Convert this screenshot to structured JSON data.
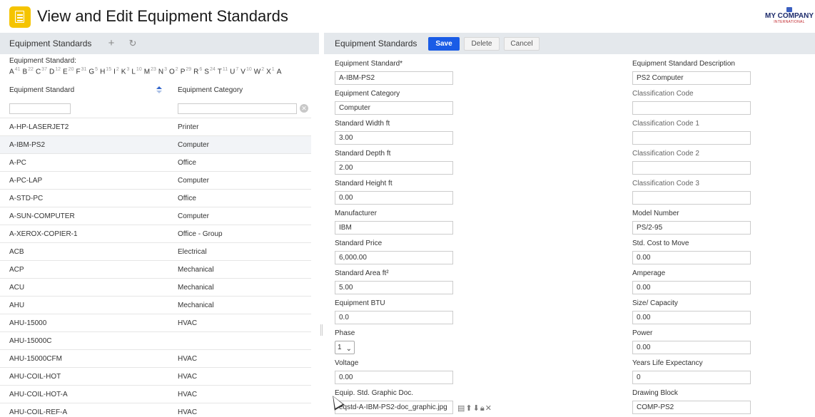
{
  "app": {
    "title": "View and Edit Equipment Standards",
    "logo_name": "MY COMPANY",
    "logo_sub": "INTERNATIONAL",
    "accent_color": "#f5c400",
    "primary_button_color": "#1a5ce6"
  },
  "list_panel": {
    "title": "Equipment Standards",
    "add_icon": "plus-icon",
    "refresh_icon": "refresh-icon",
    "index_label": "Equipment Standard:",
    "alphabet": [
      {
        "letter": "A",
        "count": "41"
      },
      {
        "letter": "B",
        "count": "22"
      },
      {
        "letter": "C",
        "count": "37"
      },
      {
        "letter": "D",
        "count": "12"
      },
      {
        "letter": "E",
        "count": "20"
      },
      {
        "letter": "F",
        "count": "31"
      },
      {
        "letter": "G",
        "count": "5"
      },
      {
        "letter": "H",
        "count": "15"
      },
      {
        "letter": "I",
        "count": "2"
      },
      {
        "letter": "K",
        "count": "3"
      },
      {
        "letter": "L",
        "count": "10"
      },
      {
        "letter": "M",
        "count": "23"
      },
      {
        "letter": "N",
        "count": "3"
      },
      {
        "letter": "O",
        "count": "2"
      },
      {
        "letter": "P",
        "count": "29"
      },
      {
        "letter": "R",
        "count": "6"
      },
      {
        "letter": "S",
        "count": "24"
      },
      {
        "letter": "T",
        "count": "11"
      },
      {
        "letter": "U",
        "count": "7"
      },
      {
        "letter": "V",
        "count": "10"
      },
      {
        "letter": "W",
        "count": "2"
      },
      {
        "letter": "X",
        "count": "1"
      },
      {
        "letter": "A",
        "count": ""
      }
    ],
    "columns": [
      "Equipment Standard",
      "Equipment Category"
    ],
    "filter_standard": "",
    "filter_category": "",
    "rows": [
      [
        "A-HP-LASERJET2",
        "Printer"
      ],
      [
        "A-IBM-PS2",
        "Computer"
      ],
      [
        "A-PC",
        "Office"
      ],
      [
        "A-PC-LAP",
        "Computer"
      ],
      [
        "A-STD-PC",
        "Office"
      ],
      [
        "A-SUN-COMPUTER",
        "Computer"
      ],
      [
        "A-XEROX-COPIER-1",
        "Office - Group"
      ],
      [
        "ACB",
        "Electrical"
      ],
      [
        "ACP",
        "Mechanical"
      ],
      [
        "ACU",
        "Mechanical"
      ],
      [
        "AHU",
        "Mechanical"
      ],
      [
        "AHU-15000",
        "HVAC"
      ],
      [
        "AHU-15000C",
        ""
      ],
      [
        "AHU-15000CFM",
        "HVAC"
      ],
      [
        "AHU-COIL-HOT",
        "HVAC"
      ],
      [
        "AHU-COIL-HOT-A",
        "HVAC"
      ],
      [
        "AHU-COIL-REF-A",
        "HVAC"
      ]
    ],
    "selected_row": 1
  },
  "form_panel": {
    "title": "Equipment Standards",
    "save_label": "Save",
    "delete_label": "Delete",
    "cancel_label": "Cancel",
    "left_fields": [
      {
        "label": "Equipment Standard*",
        "value": "A-IBM-PS2"
      },
      {
        "label": "Equipment Category",
        "value": "Computer"
      },
      {
        "label": "Standard Width ft",
        "value": "3.00"
      },
      {
        "label": "Standard Depth ft",
        "value": "2.00"
      },
      {
        "label": "Standard Height ft",
        "value": "0.00"
      },
      {
        "label": "Manufacturer",
        "value": "IBM"
      },
      {
        "label": "Standard Price",
        "value": "6,000.00"
      },
      {
        "label": "Standard Area ft²",
        "value": "5.00"
      },
      {
        "label": "Equipment BTU",
        "value": "0.0"
      },
      {
        "label": "Phase",
        "value": "1"
      },
      {
        "label": "Voltage",
        "value": "0.00"
      },
      {
        "label": "Equip. Std. Graphic Doc.",
        "value": "eqstd-A-IBM-PS2-doc_graphic.jpg"
      }
    ],
    "right_fields": [
      {
        "label": "Equipment Standard Description",
        "value": "PS2 Computer"
      },
      {
        "label": "Classification Code",
        "value": ""
      },
      {
        "label": "Classification Code 1",
        "value": ""
      },
      {
        "label": "Classification Code 2",
        "value": ""
      },
      {
        "label": "Classification Code 3",
        "value": ""
      },
      {
        "label": "Model Number",
        "value": "PS/2-95"
      },
      {
        "label": "Std. Cost to Move",
        "value": "0.00"
      },
      {
        "label": "Amperage",
        "value": "0.00"
      },
      {
        "label": "Size/ Capacity",
        "value": "0.00"
      },
      {
        "label": "Power",
        "value": "0.00"
      },
      {
        "label": "Years Life Expectancy",
        "value": "0"
      },
      {
        "label": "Drawing Block",
        "value": "COMP-PS2"
      }
    ],
    "doc_action_icons": [
      "document-icon",
      "upload-icon",
      "download-icon",
      "lock-icon",
      "delete-x-icon"
    ]
  }
}
